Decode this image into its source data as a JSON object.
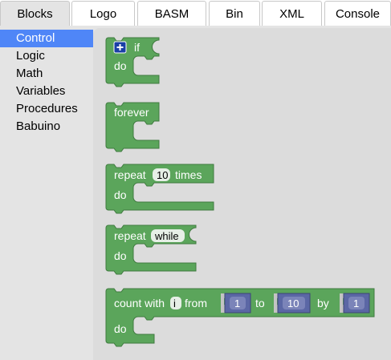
{
  "tabs": [
    {
      "label": "Blocks",
      "active": true
    },
    {
      "label": "Logo",
      "active": false
    },
    {
      "label": "BASM",
      "active": false
    },
    {
      "label": "Bin",
      "active": false
    },
    {
      "label": "XML",
      "active": false
    },
    {
      "label": "Console",
      "active": false
    }
  ],
  "categories": [
    {
      "label": "Control",
      "selected": true
    },
    {
      "label": "Logic",
      "selected": false
    },
    {
      "label": "Math",
      "selected": false
    },
    {
      "label": "Variables",
      "selected": false
    },
    {
      "label": "Procedures",
      "selected": false
    },
    {
      "label": "Babuino",
      "selected": false
    }
  ],
  "blocks": {
    "if": {
      "mutator_icon": "plus-icon",
      "label": "if",
      "do_label": "do"
    },
    "forever": {
      "label": "forever"
    },
    "repeat": {
      "label": "repeat",
      "count": "10",
      "suffix": "times",
      "do_label": "do"
    },
    "repeat_while": {
      "label": "repeat",
      "mode": "while",
      "do_label": "do"
    },
    "count_with": {
      "label": "count with",
      "var": "i",
      "from_label": "from",
      "from": "1",
      "to_label": "to",
      "to": "10",
      "by_label": "by",
      "by": "1",
      "do_label": "do"
    }
  },
  "colors": {
    "block_green": "#5ba55b",
    "block_green_dark": "#3f7a3f",
    "number_block": "#5b67a5",
    "selected_category": "#4f86f7"
  }
}
